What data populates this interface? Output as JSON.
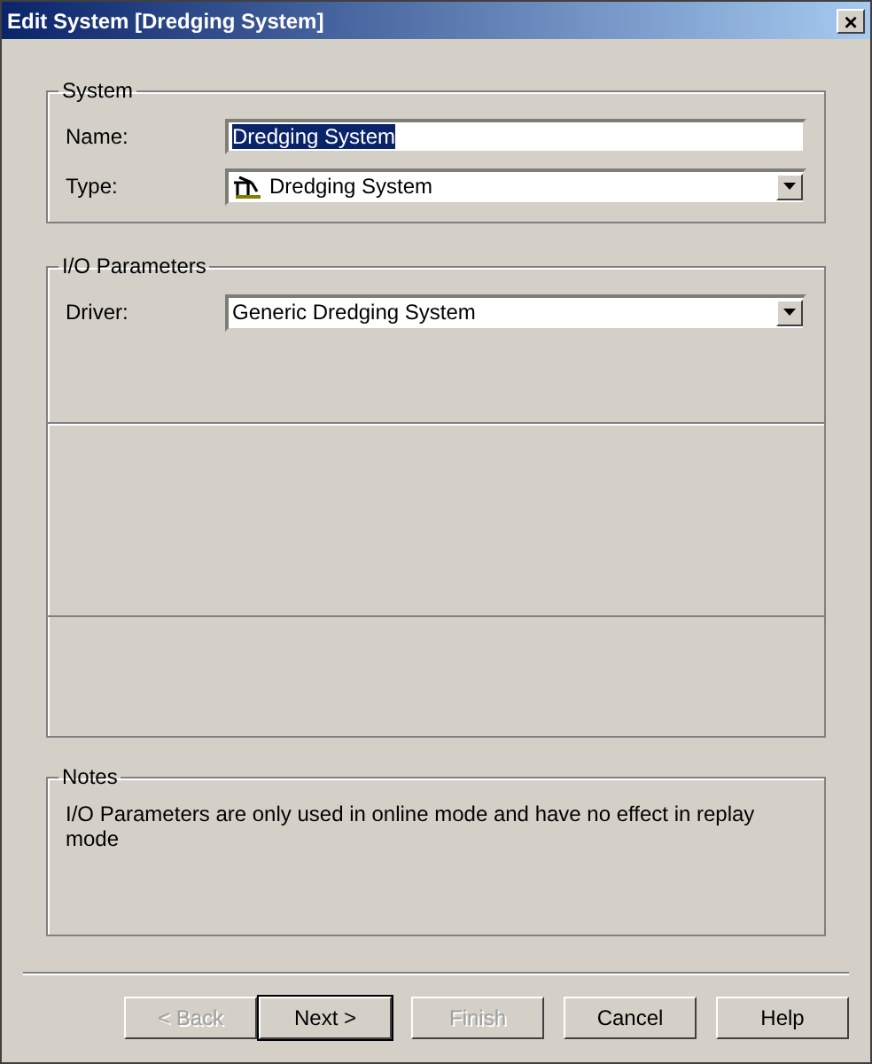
{
  "window": {
    "title": "Edit System [Dredging System]",
    "close": "×"
  },
  "system": {
    "legend": "System",
    "name_label": "Name:",
    "name_value": "Dredging System",
    "name_selected": true,
    "type_label": "Type:",
    "type_value": "Dredging System"
  },
  "io": {
    "legend": "I/O Parameters",
    "driver_label": "Driver:",
    "driver_value": "Generic Dredging System"
  },
  "notes": {
    "legend": "Notes",
    "text": "I/O Parameters are only used in online mode and have no effect in replay mode"
  },
  "buttons": [
    {
      "label": "< Back",
      "disabled": true,
      "default": false
    },
    {
      "label": "Next >",
      "disabled": false,
      "default": true
    },
    {
      "label": "Finish",
      "disabled": true,
      "default": false
    },
    {
      "label": "Cancel",
      "disabled": false,
      "default": false
    },
    {
      "label": "Help",
      "disabled": false,
      "default": false
    }
  ]
}
